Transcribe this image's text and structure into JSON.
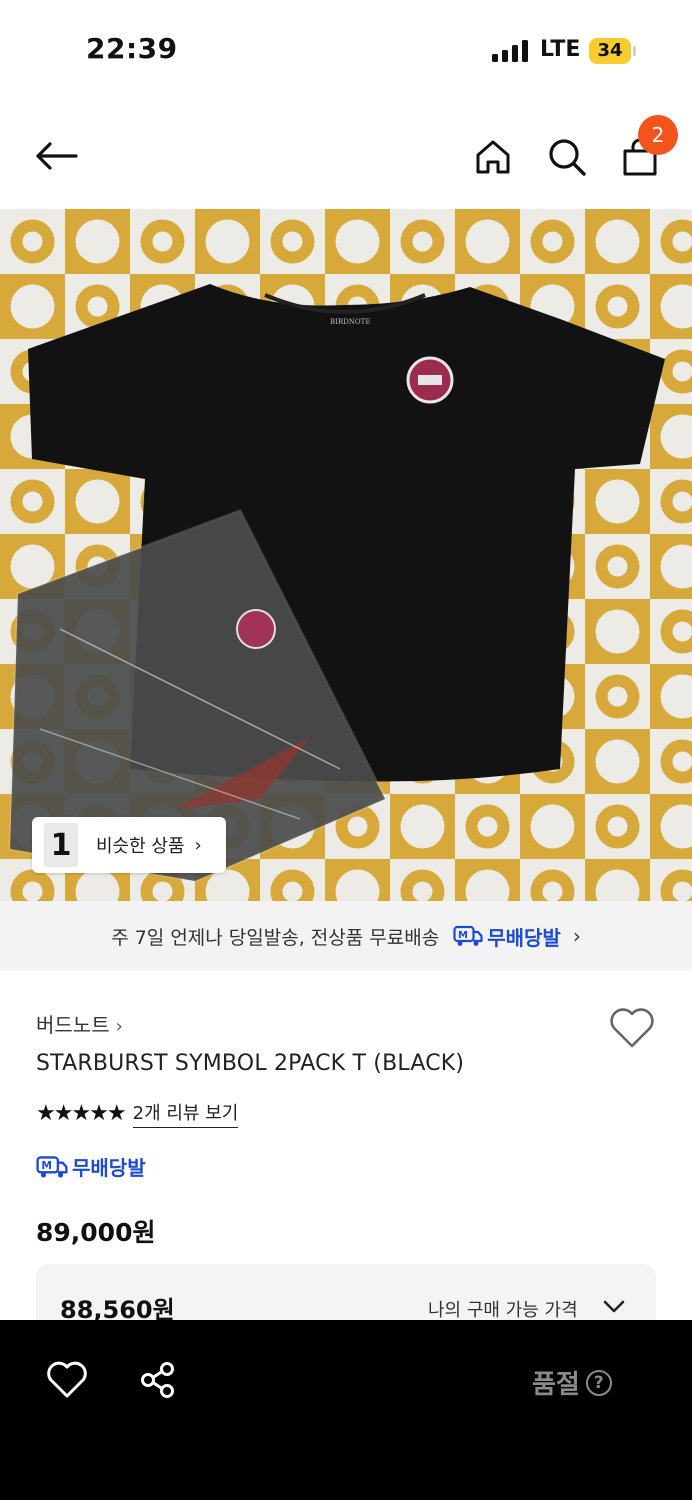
{
  "status_bar": {
    "time": "22:39",
    "network": "LTE",
    "battery": "34"
  },
  "nav": {
    "cart_count": "2"
  },
  "hero": {
    "bag_tag_text": "BIRDNOTE",
    "similar_label": "비슷한 상품",
    "similar_thumb": "1"
  },
  "shipping_banner": {
    "text": "주 7일 언제나 당일발송, 전상품 무료배송",
    "badge": "무배당발"
  },
  "product": {
    "brand": "버드노트",
    "title": "STARBURST SYMBOL 2PACK T (BLACK)",
    "stars": "★★★★★",
    "rating": 5,
    "review_link": "2개 리뷰 보기",
    "delivery_badge": "무배당발",
    "price": "89,000원",
    "my_price": "88,560원",
    "my_price_label": "나의 구매 가능 가격"
  },
  "bottom_bar": {
    "soldout_label": "품절",
    "help": "?"
  },
  "colors": {
    "accent_blue": "#1a4ad6",
    "badge_orange": "#f3541c",
    "mustard": "#d2a338"
  }
}
